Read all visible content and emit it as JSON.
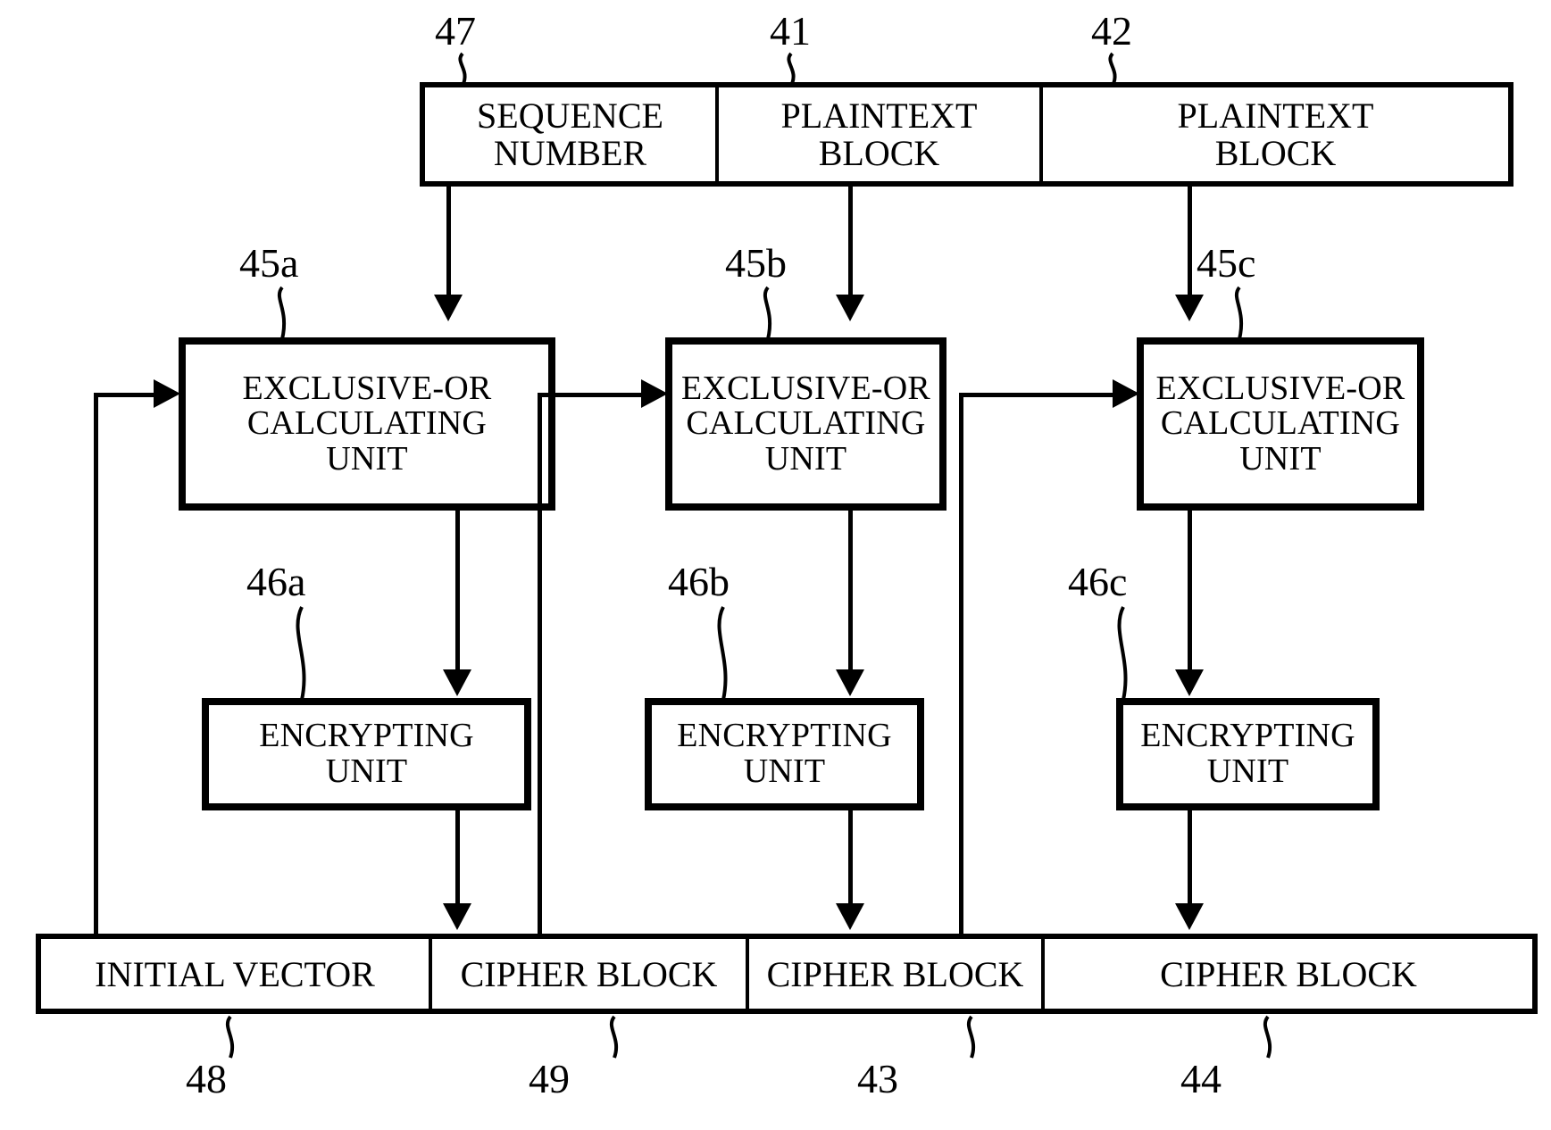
{
  "figure": {
    "type": "patent-block-diagram",
    "description": "Block cipher chaining diagram with sequence number, plaintext blocks, exclusive-or calculating units, encrypting units, initial vector and cipher blocks"
  },
  "top_row": {
    "cells": [
      {
        "label": "SEQUENCE\nNUMBER",
        "line1": "SEQUENCE",
        "line2": "NUMBER",
        "ref": "47"
      },
      {
        "label": "PLAINTEXT\nBLOCK",
        "line1": "PLAINTEXT",
        "line2": "BLOCK",
        "ref": "41"
      },
      {
        "label": "PLAINTEXT\nBLOCK",
        "line1": "PLAINTEXT",
        "line2": "BLOCK",
        "ref": "42"
      }
    ]
  },
  "xor_units": [
    {
      "line1": "EXCLUSIVE-OR",
      "line2": "CALCULATING",
      "line3": "UNIT",
      "ref": "45a"
    },
    {
      "line1": "EXCLUSIVE-OR",
      "line2": "CALCULATING",
      "line3": "UNIT",
      "ref": "45b"
    },
    {
      "line1": "EXCLUSIVE-OR",
      "line2": "CALCULATING",
      "line3": "UNIT",
      "ref": "45c"
    }
  ],
  "encrypting_units": [
    {
      "line1": "ENCRYPTING",
      "line2": "UNIT",
      "ref": "46a"
    },
    {
      "line1": "ENCRYPTING",
      "line2": "UNIT",
      "ref": "46b"
    },
    {
      "line1": "ENCRYPTING",
      "line2": "UNIT",
      "ref": "46c"
    }
  ],
  "bottom_row": {
    "cells": [
      {
        "label": "INITIAL VECTOR",
        "ref": "48"
      },
      {
        "label": "CIPHER BLOCK",
        "ref": "49"
      },
      {
        "label": "CIPHER BLOCK",
        "ref": "43"
      },
      {
        "label": "CIPHER BLOCK",
        "ref": "44"
      }
    ]
  },
  "colors": {
    "line": "#000000",
    "background": "#ffffff"
  }
}
